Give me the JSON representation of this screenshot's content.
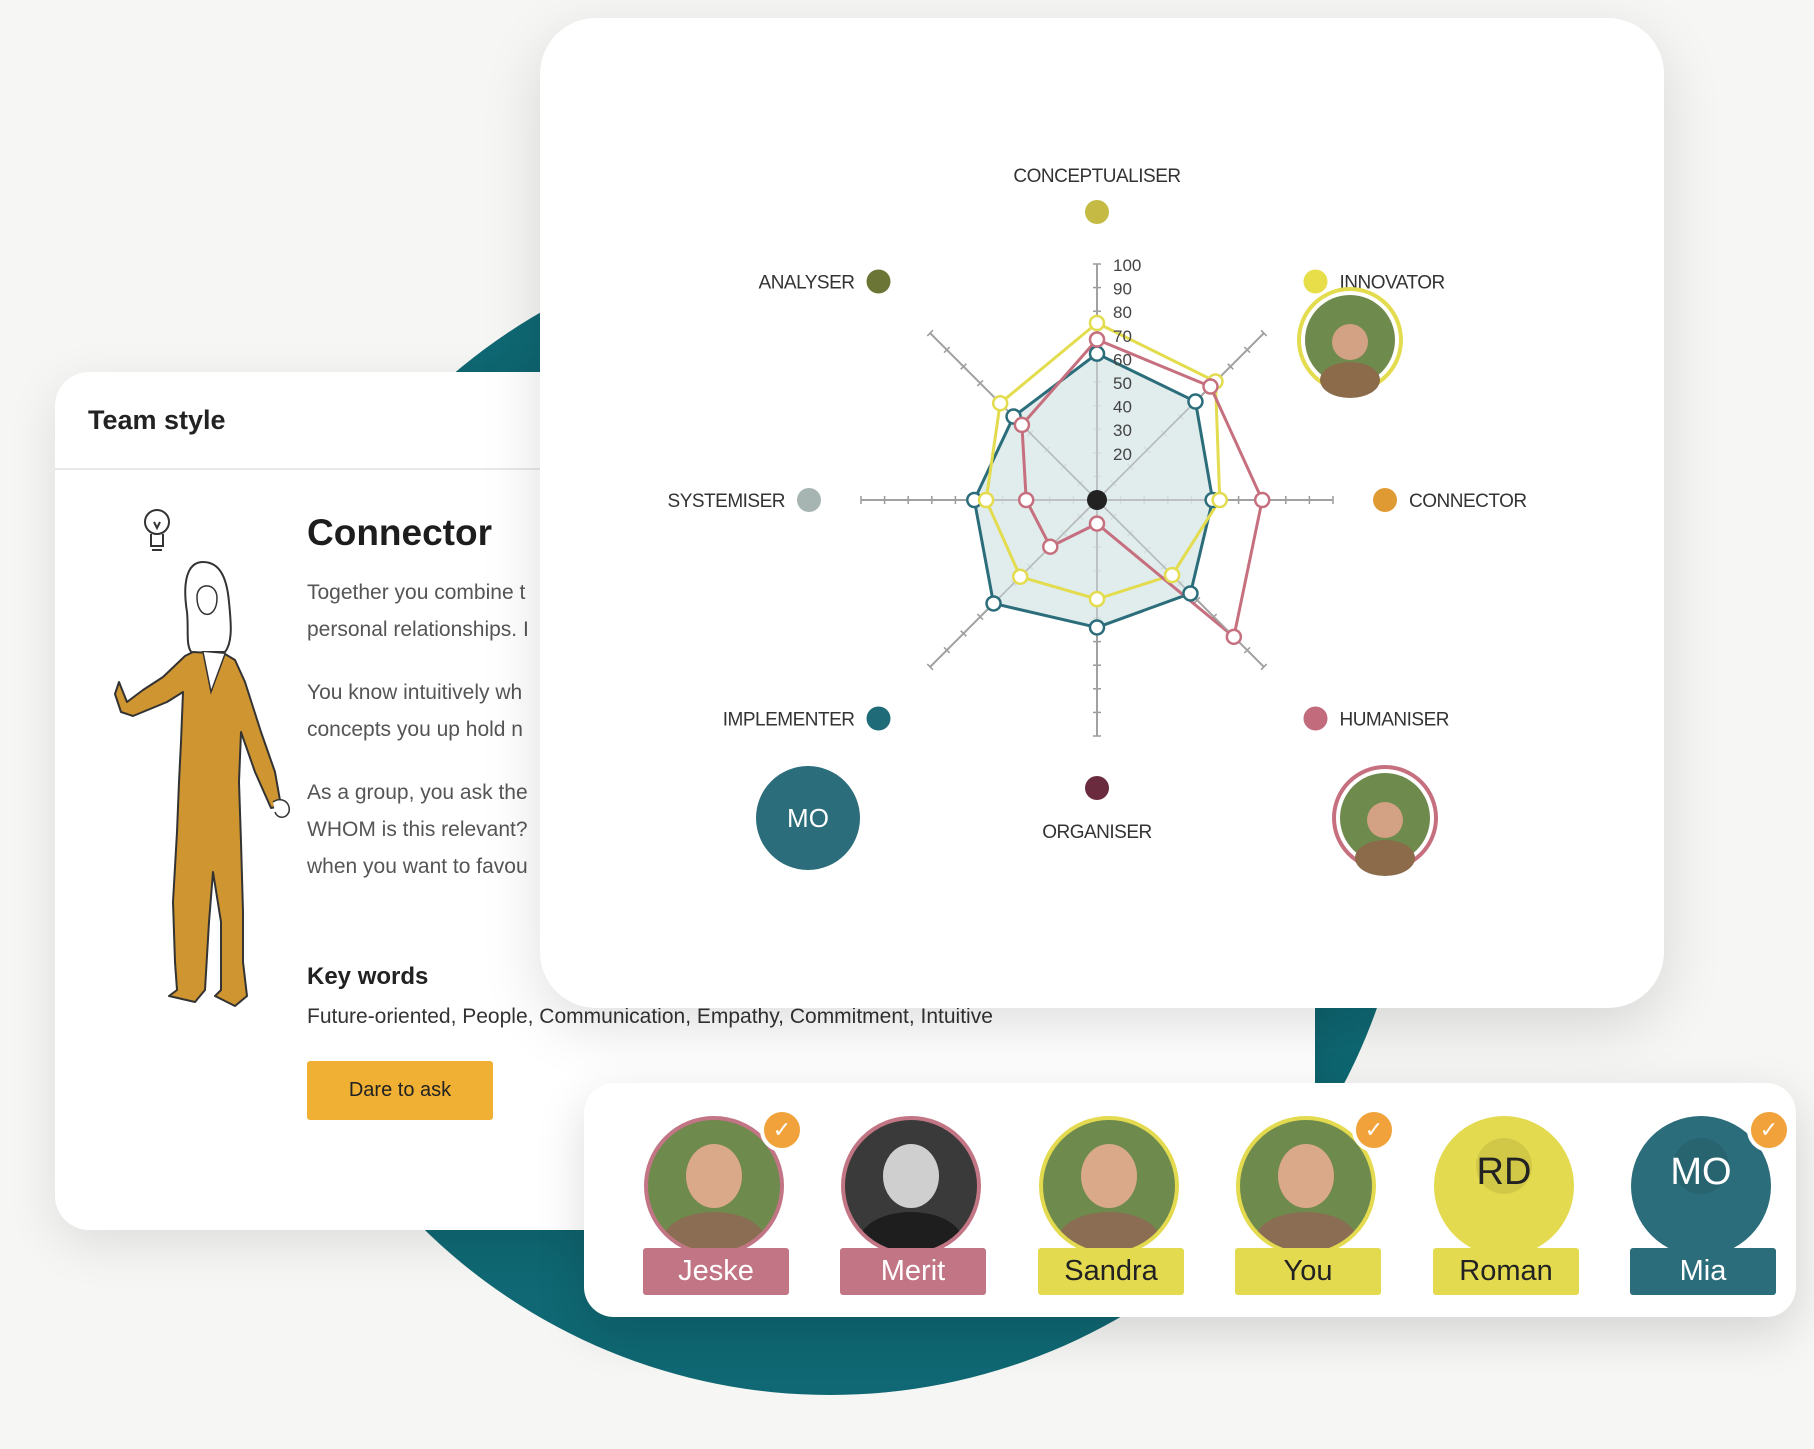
{
  "team_card": {
    "title": "Team style",
    "style_name": "Connector",
    "paragraphs": [
      "Together you combine t\npersonal relationships. I",
      "You know intuitively wh\nconcepts you up hold n",
      "As a group, you ask the\nWHOM is this relevant?\nwhen you want to favou"
    ],
    "keywords_title": "Key words",
    "keywords": "Future-oriented, People, Communication, Empathy, Commitment, Intuitive",
    "button_label": "Dare to ask",
    "icons": [
      "lightbulb-icon",
      "person-figure-illustration"
    ]
  },
  "radar": {
    "axes": [
      {
        "label": "CONCEPTUALISER",
        "color": "#c4ba44"
      },
      {
        "label": "INNOVATOR",
        "color": "#e8de4a"
      },
      {
        "label": "CONNECTOR",
        "color": "#e09a33"
      },
      {
        "label": "HUMANISER",
        "color": "#c26b7c"
      },
      {
        "label": "ORGANISER",
        "color": "#6a2b3f"
      },
      {
        "label": "IMPLEMENTER",
        "color": "#1f6b78"
      },
      {
        "label": "SYSTEMISER",
        "color": "#a6b4b2"
      },
      {
        "label": "ANALYSER",
        "color": "#6b7535"
      }
    ],
    "tick_labels": [
      "20",
      "30",
      "40",
      "50",
      "60",
      "70",
      "80",
      "90",
      "100"
    ],
    "avatar_initials": "MO",
    "colors": {
      "teal": "#2b6d7a",
      "yellow": "#e3dc4e",
      "pink": "#c6707f",
      "teal_fill": "#dce9ea"
    }
  },
  "chart_data": {
    "type": "radar",
    "categories": [
      "CONCEPTUALISER",
      "INNOVATOR",
      "CONNECTOR",
      "HUMANISER",
      "ORGANISER",
      "IMPLEMENTER",
      "SYSTEMISER",
      "ANALYSER"
    ],
    "rlim": [
      0,
      100
    ],
    "ticks": [
      20,
      30,
      40,
      50,
      60,
      70,
      80,
      90,
      100
    ],
    "series": [
      {
        "color": "#2b6d7a",
        "filled": true,
        "values": [
          62,
          59,
          49,
          56,
          54,
          62,
          52,
          50
        ]
      },
      {
        "color": "#e3dc4e",
        "filled": false,
        "values": [
          75,
          71,
          52,
          45,
          42,
          46,
          47,
          58
        ]
      },
      {
        "color": "#c6707f",
        "filled": false,
        "values": [
          68,
          68,
          70,
          82,
          10,
          28,
          30,
          45
        ]
      }
    ]
  },
  "members": [
    {
      "name": "Jeske",
      "initials": "",
      "tag_color": "#c27584",
      "ring_color": "#c27584",
      "photo": "photo",
      "checked": true
    },
    {
      "name": "Merit",
      "initials": "",
      "tag_color": "#c27584",
      "ring_color": "#c27584",
      "photo": "photo-bw",
      "checked": false
    },
    {
      "name": "Sandra",
      "initials": "",
      "tag_color": "#e3da4f",
      "ring_color": "#e3da4f",
      "photo": "photo",
      "checked": false
    },
    {
      "name": "You",
      "initials": "",
      "tag_color": "#e3da4f",
      "ring_color": "#e3da4f",
      "photo": "photo",
      "checked": true
    },
    {
      "name": "Roman",
      "initials": "RD",
      "tag_color": "#e3da4f",
      "ring_color": "#e3da4f",
      "photo": "none",
      "checked": false
    },
    {
      "name": "Mia",
      "initials": "MO",
      "tag_color": "#2b6d7a",
      "ring_color": "#2b6d7a",
      "photo": "none",
      "checked": true
    }
  ]
}
